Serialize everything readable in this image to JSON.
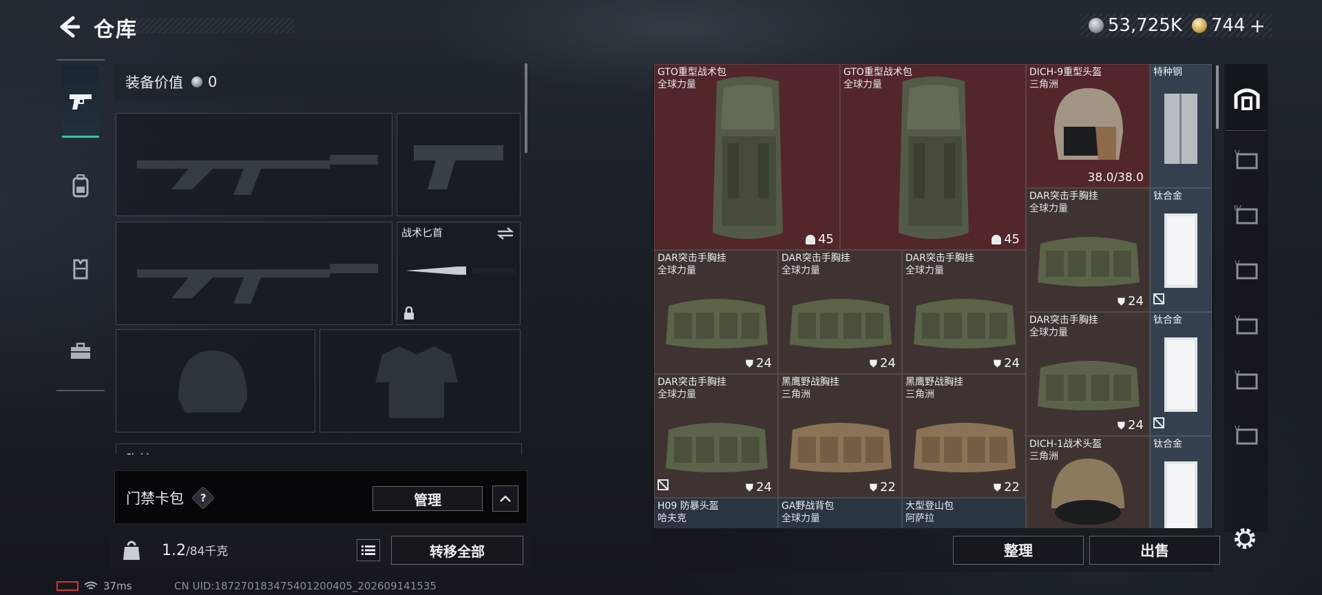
{
  "header": {
    "title": "仓库",
    "currency_silver": "53,725K",
    "currency_gold": "744",
    "gold_plus": "+"
  },
  "left_nav": [
    {
      "icon": "pistol-icon",
      "active": true
    },
    {
      "icon": "backpack-icon",
      "active": false
    },
    {
      "icon": "vest-icon",
      "active": false
    },
    {
      "icon": "toolbox-icon",
      "active": false
    }
  ],
  "equipment": {
    "value_label": "装备价值",
    "value": "0",
    "knife_label": "战术匕首",
    "chest_rig_label": "胸挂",
    "chest_rig_q": "?"
  },
  "card_bag": {
    "label": "门禁卡包",
    "help": "?",
    "manage_label": "管理"
  },
  "bottom_bar": {
    "weight_current": "1.2",
    "weight_max": "/84千克",
    "transfer_all_label": "转移全部"
  },
  "status": {
    "ping": "37ms",
    "uid": "CN UID:18727018347540120040​5_202609141535"
  },
  "stash": {
    "items": [
      {
        "name": "GTO重型战术包",
        "sub": "全球力量",
        "value": "45",
        "value_icon": "capacity-icon"
      },
      {
        "name": "GTO重型战术包",
        "sub": "全球力量",
        "value": "45",
        "value_icon": "capacity-icon"
      },
      {
        "name": "DICH-9重型头盔",
        "sub": "三角洲",
        "value": "38.0/38.0"
      },
      {
        "name": "特种钢",
        "sub": ""
      },
      {
        "name": "DAR突击手胸挂",
        "sub": "全球力量",
        "value": "24",
        "value_icon": "vest-capacity-icon"
      },
      {
        "name": "钛合金",
        "sub": ""
      },
      {
        "name": "DAR突击手胸挂",
        "sub": "全球力量",
        "value": "24",
        "value_icon": "vest-capacity-icon"
      },
      {
        "name": "DAR突击手胸挂",
        "sub": "全球力量",
        "value": "24",
        "value_icon": "vest-capacity-icon"
      },
      {
        "name": "DAR突击手胸挂",
        "sub": "全球力量",
        "value": "24",
        "value_icon": "vest-capacity-icon"
      },
      {
        "name": "DAR突击手胸挂",
        "sub": "全球力量",
        "value": "24",
        "value_icon": "vest-capacity-icon"
      },
      {
        "name": "钛合金",
        "sub": ""
      },
      {
        "name": "DAR突击手胸挂",
        "sub": "全球力量",
        "value": "24",
        "value_icon": "vest-capacity-icon"
      },
      {
        "name": "黑鹰野战胸挂",
        "sub": "三角洲",
        "value": "22",
        "value_icon": "vest-capacity-icon"
      },
      {
        "name": "黑鹰野战胸挂",
        "sub": "三角洲",
        "value": "22",
        "value_icon": "vest-capacity-icon"
      },
      {
        "name": "DICH-1战术头盔",
        "sub": "三角洲"
      },
      {
        "name": "钛合金",
        "sub": ""
      },
      {
        "name": "H09 防暴头盔",
        "sub": "哈夫克"
      },
      {
        "name": "GA野战背包",
        "sub": "全球力量"
      },
      {
        "name": "大型登山包",
        "sub": "阿萨拉"
      }
    ],
    "sort_label": "整理",
    "sell_label": "出售"
  },
  "colors": {
    "accent": "#34c7a5",
    "red_rarity": "#52262a",
    "brown_rarity": "#3e3330",
    "gray_rarity": "#2b3441"
  }
}
